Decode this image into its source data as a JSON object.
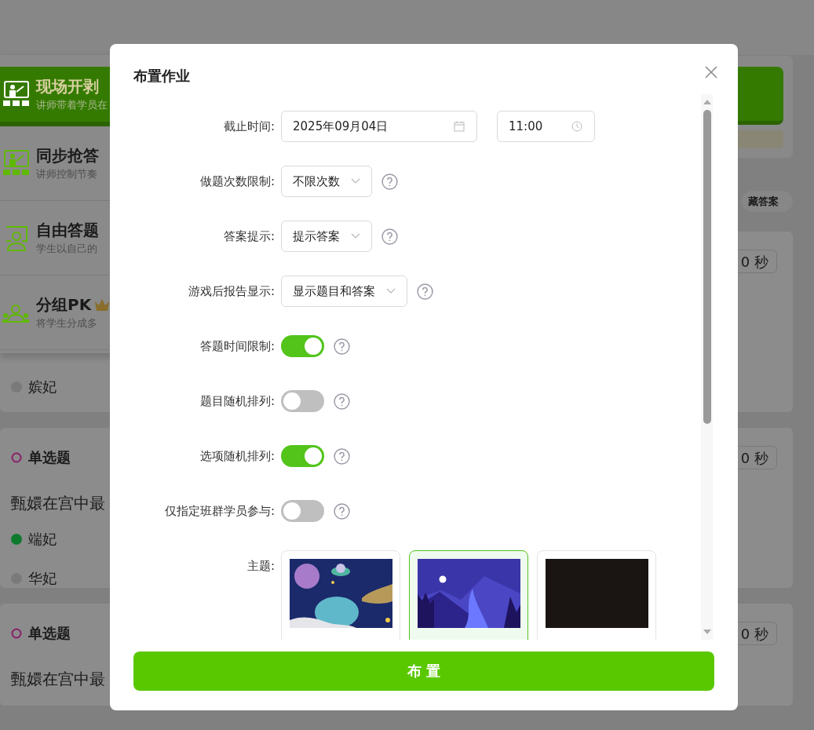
{
  "background": {
    "modes": [
      {
        "title": "现场开剥",
        "description": "讲师带着学员在",
        "selected": true
      },
      {
        "title": "同步抢答",
        "description": "讲师控制节奏",
        "selected": false
      },
      {
        "title": "自由答题",
        "description": "学生以自己的",
        "selected": false
      },
      {
        "title": "分组PK",
        "description": "将学生分成多",
        "selected": false,
        "crown": true
      }
    ],
    "pill_text": "藏答案",
    "questions": [
      {
        "time": "0 秒",
        "options": [
          {
            "text": "嫔妃",
            "color": "#7a7a7a"
          }
        ]
      },
      {
        "type": "单选题",
        "time": "0 秒",
        "question": "甄嬛在宫中最",
        "options": [
          {
            "text": "端妃",
            "color": "#0f7a2e"
          },
          {
            "text": "华妃",
            "color": "#7a7a7a"
          }
        ]
      },
      {
        "type": "单选题",
        "time": "0 秒",
        "question": "甄嬛在宫中最"
      }
    ]
  },
  "dialog": {
    "title": "布置作业",
    "fields": [
      {
        "kind": "date",
        "label": "截止时间:",
        "value": "2025年09月04日",
        "time": "11:00"
      },
      {
        "kind": "select",
        "label": "做题次数限制:",
        "value": "不限次数",
        "help": true
      },
      {
        "kind": "select",
        "label": "答案提示:",
        "value": "提示答案",
        "help": true
      },
      {
        "kind": "select",
        "label": "游戏后报告显示:",
        "value": "显示题目和答案",
        "help": true
      },
      {
        "kind": "switch",
        "label": "答题时间限制:",
        "on": true,
        "help": true
      },
      {
        "kind": "switch",
        "label": "题目随机排列:",
        "on": false,
        "help": true
      },
      {
        "kind": "switch",
        "label": "选项随机排列:",
        "on": true,
        "help": true
      },
      {
        "kind": "switch",
        "label": "仅指定班群学员参与:",
        "on": false,
        "help": true
      },
      {
        "kind": "themes",
        "label": "主题:",
        "themes": [
          {
            "selected": false
          },
          {
            "selected": true
          },
          {
            "selected": false
          }
        ]
      }
    ],
    "submit": "布 置"
  }
}
